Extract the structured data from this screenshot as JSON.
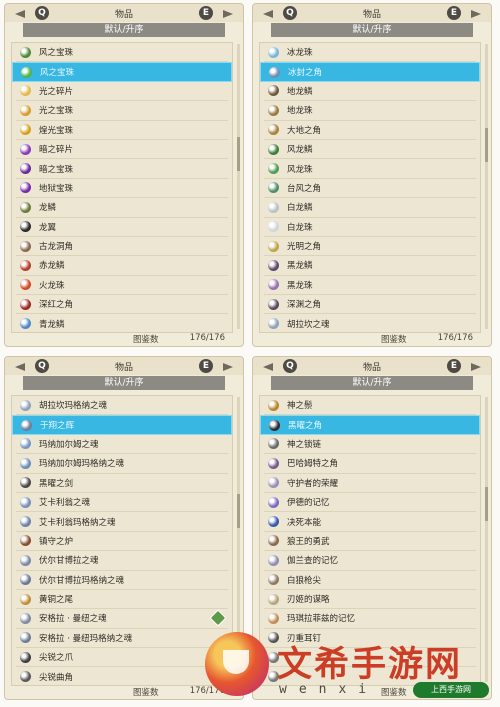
{
  "panels": [
    {
      "title": "物品",
      "sort_label": "默认/升序",
      "footer_label": "图鉴数",
      "footer_value": "176/176",
      "selected_index": 1,
      "items": [
        {
          "name": "风之宝珠",
          "color": "#4f8a3b"
        },
        {
          "name": "风之宝珠",
          "color": "#4fb64a"
        },
        {
          "name": "光之碎片",
          "color": "#e7b84d"
        },
        {
          "name": "光之宝珠",
          "color": "#d79d2f"
        },
        {
          "name": "煌光宝珠",
          "color": "#d6a11f"
        },
        {
          "name": "暗之碎片",
          "color": "#8b3cb4"
        },
        {
          "name": "暗之宝珠",
          "color": "#6b2a96"
        },
        {
          "name": "地狱宝珠",
          "color": "#7b2aa8"
        },
        {
          "name": "龙鳞",
          "color": "#6c7c3a"
        },
        {
          "name": "龙翼",
          "color": "#2b2b2b"
        },
        {
          "name": "古龙洞角",
          "color": "#8b6a4f"
        },
        {
          "name": "赤龙鳞",
          "color": "#b2412a"
        },
        {
          "name": "火龙珠",
          "color": "#d24a2b"
        },
        {
          "name": "深红之角",
          "color": "#9c2c23"
        },
        {
          "name": "青龙鳞",
          "color": "#4f8ac2"
        }
      ]
    },
    {
      "title": "物品",
      "sort_label": "默认/升序",
      "footer_label": "图鉴数",
      "footer_value": "176/176",
      "selected_index": 1,
      "items": [
        {
          "name": "冰龙珠",
          "color": "#7ab6d9"
        },
        {
          "name": "冰封之角",
          "color": "#6f8fb1"
        },
        {
          "name": "地龙鳞",
          "color": "#6f5a3d"
        },
        {
          "name": "地龙珠",
          "color": "#9c7b41"
        },
        {
          "name": "大地之角",
          "color": "#a9823f"
        },
        {
          "name": "风龙鳞",
          "color": "#3f7f3b"
        },
        {
          "name": "风龙珠",
          "color": "#4f9d55"
        },
        {
          "name": "台风之角",
          "color": "#4f8f63"
        },
        {
          "name": "白龙鳞",
          "color": "#b8c1c6"
        },
        {
          "name": "白龙珠",
          "color": "#cfd6da"
        },
        {
          "name": "光明之角",
          "color": "#c2a34a"
        },
        {
          "name": "黑龙鳞",
          "color": "#5d4a6a"
        },
        {
          "name": "黑龙珠",
          "color": "#9b72b0"
        },
        {
          "name": "深渊之角",
          "color": "#5a4b5f"
        },
        {
          "name": "胡拉坎之魂",
          "color": "#8da3b9"
        }
      ]
    },
    {
      "title": "物品",
      "sort_label": "默认/升序",
      "footer_label": "图鉴数",
      "footer_value": "176/176",
      "selected_index": 1,
      "tag_index": 11,
      "items": [
        {
          "name": "胡拉坎玛格纳之魂",
          "color": "#8da3b9"
        },
        {
          "name": "于翔之辉",
          "color": "#6f7f9a"
        },
        {
          "name": "玛纳加尔姆之魂",
          "color": "#7a98c5"
        },
        {
          "name": "玛纳加尔姆玛格纳之魂",
          "color": "#6e8fb6"
        },
        {
          "name": "黑曜之剑",
          "color": "#4a4a4a"
        },
        {
          "name": "艾卡利翁之魂",
          "color": "#7a90b8"
        },
        {
          "name": "艾卡利翁玛格纳之魂",
          "color": "#6c82aa"
        },
        {
          "name": "镇守之炉",
          "color": "#8b4f2e"
        },
        {
          "name": "伏尔甘博拉之魂",
          "color": "#7a8aa6"
        },
        {
          "name": "伏尔甘博拉玛格纳之魂",
          "color": "#687a98"
        },
        {
          "name": "黄铜之尾",
          "color": "#c0913a"
        },
        {
          "name": "安格拉 · 曼纽之魂",
          "color": "#7f8ba0"
        },
        {
          "name": "安格拉 · 曼纽玛格纳之魂",
          "color": "#6f7d94"
        },
        {
          "name": "尖锐之爪",
          "color": "#3f3f3f"
        },
        {
          "name": "尖锐曲角",
          "color": "#5a5a5a"
        }
      ]
    },
    {
      "title": "物品",
      "sort_label": "默认/升序",
      "footer_label": "图鉴数",
      "footer_value": "176/176",
      "selected_index": 1,
      "items": [
        {
          "name": "神之鬃",
          "color": "#b7862e"
        },
        {
          "name": "黑曜之角",
          "color": "#2e2e2e"
        },
        {
          "name": "神之锁链",
          "color": "#6b6b6b"
        },
        {
          "name": "巴哈姆特之角",
          "color": "#7a5a8f"
        },
        {
          "name": "守护者的荣耀",
          "color": "#9c8fb4"
        },
        {
          "name": "伊德的记忆",
          "color": "#7d6bbf"
        },
        {
          "name": "决死本能",
          "color": "#3a5aa8"
        },
        {
          "name": "狼王的勇武",
          "color": "#8a6a4b"
        },
        {
          "name": "伽兰查的记忆",
          "color": "#8f8fb6"
        },
        {
          "name": "白狼枪尖",
          "color": "#8f7a64"
        },
        {
          "name": "刃姬的谋略",
          "color": "#b9a37a"
        },
        {
          "name": "玛琪拉菲兹的记忆",
          "color": "#c48b5a"
        },
        {
          "name": "刃重耳钉",
          "color": "#555555"
        },
        {
          "name": "",
          "color": "#777777"
        },
        {
          "name": "",
          "color": "#777777"
        }
      ]
    }
  ],
  "watermark": {
    "cn": "文希手游网",
    "en": "wenxi",
    "badge": "上西手游网"
  }
}
